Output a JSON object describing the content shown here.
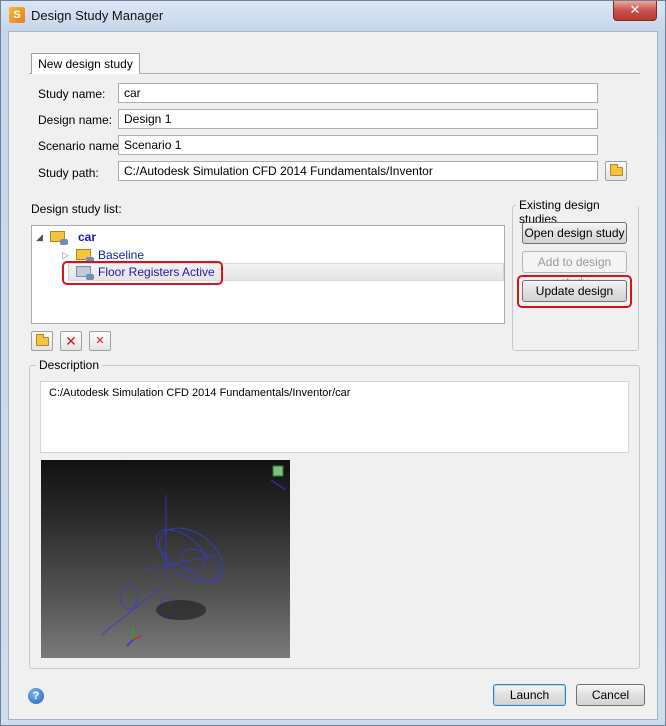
{
  "window": {
    "title": "Design Study Manager",
    "close_glyph": "✕"
  },
  "tabs": [
    {
      "label": "New design study"
    }
  ],
  "form": {
    "study_name_label": "Study name:",
    "study_name_value": "car",
    "design_name_label": "Design name:",
    "design_name_value": "Design 1",
    "scenario_name_label": "Scenario name:",
    "scenario_name_value": "Scenario 1",
    "study_path_label": "Study path:",
    "study_path_value": "C:/Autodesk Simulation CFD 2014 Fundamentals/Inventor"
  },
  "study_list": {
    "label": "Design study list:",
    "root": {
      "label": "car",
      "expanded": true
    },
    "children": [
      {
        "label": "Baseline",
        "selected": false
      },
      {
        "label": "Floor Registers Active",
        "selected": true
      }
    ]
  },
  "existing": {
    "title": "Existing design studies",
    "open_label": "Open design study",
    "add_label": "Add to design study",
    "update_label": "Update design"
  },
  "description": {
    "title": "Description",
    "text": "C:/Autodesk Simulation CFD 2014 Fundamentals/Inventor/car"
  },
  "footer": {
    "help_glyph": "?",
    "launch_label": "Launch",
    "cancel_label": "Cancel"
  },
  "icons": {
    "app": "autodesk-app-icon",
    "open_folder": "open-folder-icon",
    "delete": "delete-x-icon",
    "delete_all": "delete-multiple-icon",
    "help": "help-icon"
  },
  "colors": {
    "highlight_outline": "#d9121b",
    "tree_text": "#1a1aa5",
    "folder": "#f3c43c"
  }
}
